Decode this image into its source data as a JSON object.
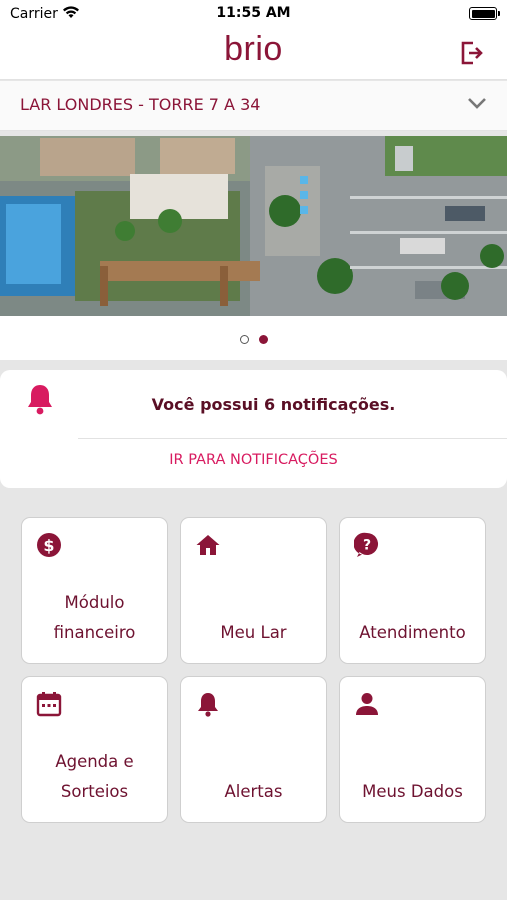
{
  "status_bar": {
    "carrier": "Carrier",
    "time": "11:55 AM"
  },
  "header": {
    "logo": "brio"
  },
  "selector": {
    "label": "LAR LONDRES - TORRE 7 A 34"
  },
  "notifications": {
    "message": "Você possui 6 notificações.",
    "link": "IR PARA NOTIFICAÇÕES"
  },
  "menu": {
    "financeiro": "Módulo\nfinanceiro",
    "meu_lar": "Meu Lar",
    "atendimento": "Atendimento",
    "agenda": "Agenda e\nSorteios",
    "alertas": "Alertas",
    "meus_dados": "Meus Dados"
  },
  "colors": {
    "brand": "#8b1538",
    "accent": "#d81b60",
    "background": "#e6e6e6"
  },
  "icons": [
    "wifi-icon",
    "battery-icon",
    "logout-icon",
    "chevron-down-icon",
    "bell-icon",
    "dollar-icon",
    "home-icon",
    "help-icon",
    "calendar-icon",
    "person-icon"
  ]
}
